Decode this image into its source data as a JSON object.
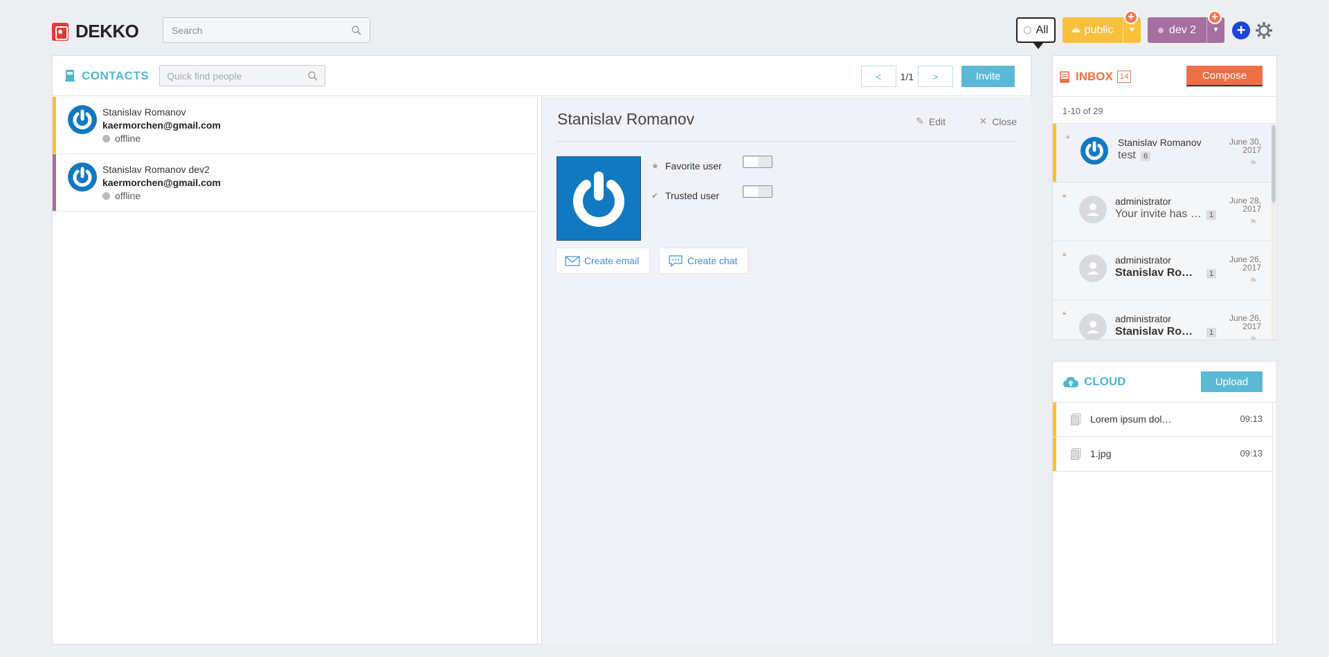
{
  "app": {
    "name": "DEKKO",
    "brand_color": "#e53935"
  },
  "header": {
    "search_placeholder": "Search",
    "filter_all_label": "All",
    "spaces": [
      {
        "label": "public",
        "color": "#f9c03d"
      },
      {
        "label": "dev 2",
        "color": "#a56fa0"
      }
    ],
    "icons": [
      "search-icon",
      "plus-icon",
      "add-space-icon",
      "gear-icon",
      "chevron-down-icon"
    ]
  },
  "contacts": {
    "title": "CONTACTS",
    "quick_find_placeholder": "Quick find people",
    "pager": {
      "prev": "<",
      "page": "1/1",
      "next": ">"
    },
    "invite_label": "Invite",
    "list": [
      {
        "name": "Stanislav Romanov",
        "email": "kaermorchen@gmail.com",
        "status": "offline",
        "strip_color": "#f9c03d"
      },
      {
        "name": "Stanislav Romanov dev2",
        "email": "kaermorchen@gmail.com",
        "status": "offline",
        "strip_color": "#a56fa0"
      }
    ],
    "detail": {
      "name": "Stanislav Romanov",
      "edit_label": "Edit",
      "close_label": "Close",
      "favorite_label": "Favorite user",
      "trusted_label": "Trusted user",
      "favorite_on": false,
      "trusted_on": false,
      "create_email_label": "Create email",
      "create_chat_label": "Create chat"
    }
  },
  "inbox": {
    "title": "INBOX",
    "count": "14",
    "compose_label": "Compose",
    "range": "1-10 of 29",
    "messages": [
      {
        "from": "Stanislav Romanov",
        "subject": "test",
        "count": "6",
        "date_line1": "June 30,",
        "date_line2": "2017",
        "bold": false
      },
      {
        "from": "administrator",
        "subject": "Your invite has …",
        "count": "1",
        "date_line1": "June 28,",
        "date_line2": "2017",
        "bold": false
      },
      {
        "from": "administrator",
        "subject": "Stanislav Ro…",
        "count": "1",
        "date_line1": "June 26,",
        "date_line2": "2017",
        "bold": true
      },
      {
        "from": "administrator",
        "subject": "Stanislav Ro…",
        "count": "1",
        "date_line1": "June 26,",
        "date_line2": "2017",
        "bold": true
      }
    ]
  },
  "cloud": {
    "title": "CLOUD",
    "upload_label": "Upload",
    "files": [
      {
        "name": "Lorem ipsum dol…",
        "time": "09:13"
      },
      {
        "name": "1.jpg",
        "time": "09:13"
      }
    ]
  }
}
